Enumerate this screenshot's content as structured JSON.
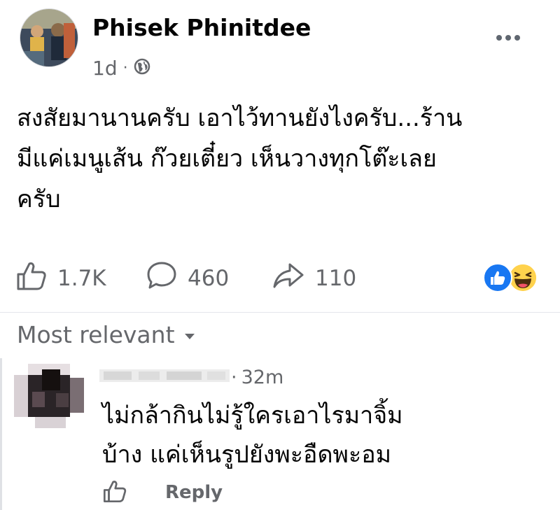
{
  "post": {
    "author": "Phisek Phinitdee",
    "time": "1d",
    "separator": "·",
    "privacy_icon": "globe-icon",
    "more_icon": "more-options-icon",
    "text_lines": [
      "สงสัยมานานครับ เอาไว้ทานยังไงครับ...ร้าน",
      "มีแค่เมนูเส้น ก๊วยเตี๋ยว เห็นวางทุกโต๊ะเลย",
      "ครับ"
    ]
  },
  "actions": {
    "like_icon": "thumbs-up-icon",
    "like_count": "1.7K",
    "comment_icon": "comment-bubble-icon",
    "comment_count": "460",
    "share_icon": "share-arrow-icon",
    "share_count": "110",
    "reactions": [
      "like",
      "haha"
    ]
  },
  "comments": {
    "sort_label": "Most relevant",
    "items": [
      {
        "time": "32m",
        "separator": "·",
        "text_lines": [
          "ไม่กล้ากินไม่รู้ใครเอาไรมาจิ้ม",
          "บ้าง แค่เห็นรูปยังพะอืดพะอม"
        ],
        "reply_label": "Reply"
      }
    ]
  },
  "colors": {
    "text": "#050505",
    "secondary_text": "#65676b",
    "like_blue": "#1877f2",
    "haha_yellow": "#ffd24d"
  }
}
